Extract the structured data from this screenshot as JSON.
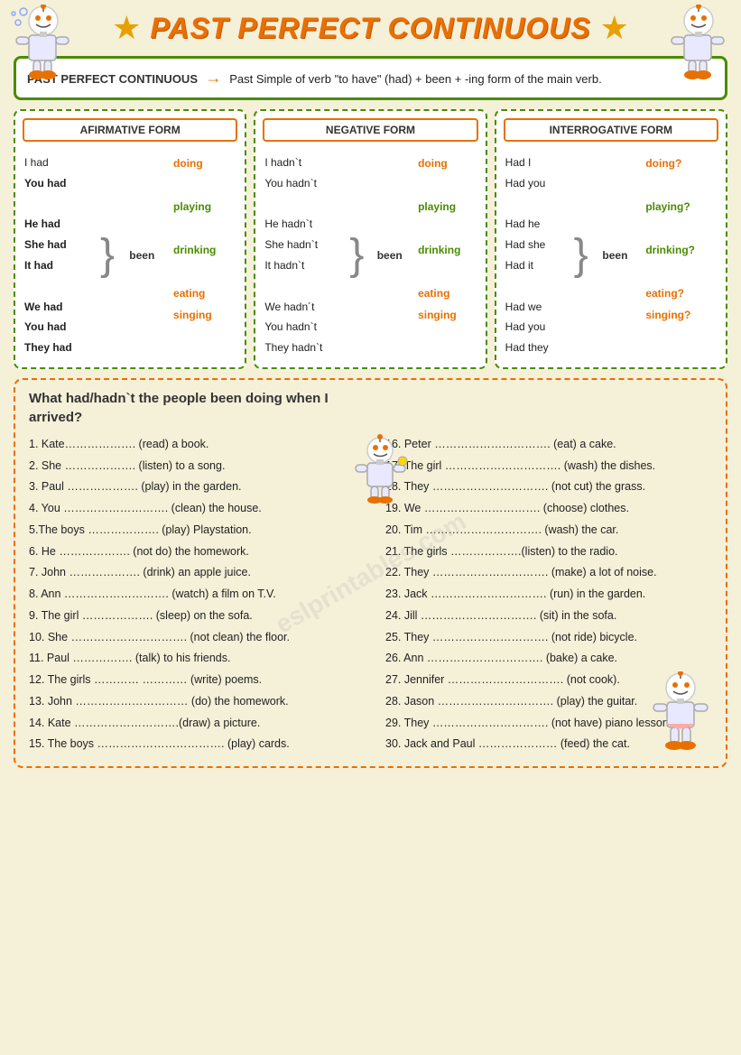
{
  "header": {
    "title": "PAST PERFECT CONTINUOUS"
  },
  "definition": {
    "label": "PAST PERFECT CONTINUOUS",
    "arrow": "→",
    "text": " Past Simple of verb \"to have\" (had) + been + -ing form of the main verb."
  },
  "forms": {
    "affirmative": {
      "header": "AFIRMATIVE FORM",
      "pronouns": [
        "I had",
        "You had",
        "He had",
        "She had",
        "It had",
        "We had",
        "You had",
        "They had"
      ],
      "been": "been",
      "verbs": [
        "doing",
        "playing",
        "drinking",
        "eating",
        "singing"
      ]
    },
    "negative": {
      "header": "NEGATIVE FORM",
      "pronouns": [
        "I hadn`t",
        "You hadn`t",
        "He hadn`t",
        "She hadn`t",
        "It hadn`t",
        "We hadn´t",
        "You hadn`t",
        "They hadn`t"
      ],
      "been": "been",
      "verbs": [
        "doing",
        "playing",
        "drinking",
        "eating",
        "singing"
      ]
    },
    "interrogative": {
      "header": "INTERROGATIVE FORM",
      "pronouns": [
        "Had I",
        "Had you",
        "Had he",
        "Had she",
        "Had it",
        "Had we",
        "Had you",
        "Had they"
      ],
      "been": "been",
      "verbs": [
        "doing?",
        "playing?",
        "drinking?",
        "eating?",
        "singing?"
      ]
    }
  },
  "exercise": {
    "title": "What had/hadn`t the people been doing when I arrived?",
    "left_items": [
      {
        "num": "1.",
        "text": "Kate ………………. (read) a book."
      },
      {
        "num": "2.",
        "text": "She ………………. (listen) to a song."
      },
      {
        "num": "3.",
        "text": "Paul ………………. (play) in the garden."
      },
      {
        "num": "4.",
        "text": "You ………………………. (clean) the house."
      },
      {
        "num": "5.",
        "text": "The boys ………………. (play) Playstation."
      },
      {
        "num": "6.",
        "text": "He ………………. (not do) the homework."
      },
      {
        "num": "7.",
        "text": "John ………………. (drink) an apple juice."
      },
      {
        "num": "8.",
        "text": "Ann ………………………. (watch) a film on T.V."
      },
      {
        "num": "9.",
        "text": "The girl ………………. (sleep) on the sofa."
      },
      {
        "num": "10.",
        "text": "She …………………………. (not clean) the floor."
      },
      {
        "num": "11.",
        "text": "Paul ……………. (talk) to his friends."
      },
      {
        "num": "12.",
        "text": "The girls ………… ………… (write) poems."
      },
      {
        "num": "13.",
        "text": "John ………………………… (do) the homework."
      },
      {
        "num": "14.",
        "text": "Kate ……………………….(draw) a picture."
      },
      {
        "num": "15.",
        "text": "The boys …………………………… (play) cards."
      }
    ],
    "right_items": [
      {
        "num": "16.",
        "text": "Peter …………………………. (eat) a cake."
      },
      {
        "num": "17.",
        "text": "The girl …………………………. (wash) the dishes."
      },
      {
        "num": "18.",
        "text": "They …………………………. (not cut) the grass."
      },
      {
        "num": "19.",
        "text": "We …………………………. (choose) clothes."
      },
      {
        "num": "20.",
        "text": "Tim …………………………. (wash) the car."
      },
      {
        "num": "21.",
        "text": "The girls ……………….(listen) to the radio."
      },
      {
        "num": "22.",
        "text": "They …………………………. (make) a lot of noise."
      },
      {
        "num": "23.",
        "text": "Jack …………………………. (run) in the garden."
      },
      {
        "num": "24.",
        "text": "Jill …………………………. (sit) in the sofa."
      },
      {
        "num": "25.",
        "text": "They …………………………. (not ride) bicycle."
      },
      {
        "num": "26.",
        "text": "Ann …………………………. (bake) a cake."
      },
      {
        "num": "27.",
        "text": "Jennifer …………………………. (not cook)."
      },
      {
        "num": "28.",
        "text": "Jason …………………………. (play) the guitar."
      },
      {
        "num": "29.",
        "text": "They …………………………. (not have) piano lessons."
      },
      {
        "num": "30.",
        "text": "Jack and Paul ………………… (feed) the cat."
      }
    ]
  },
  "watermark": "eslprintables.com"
}
